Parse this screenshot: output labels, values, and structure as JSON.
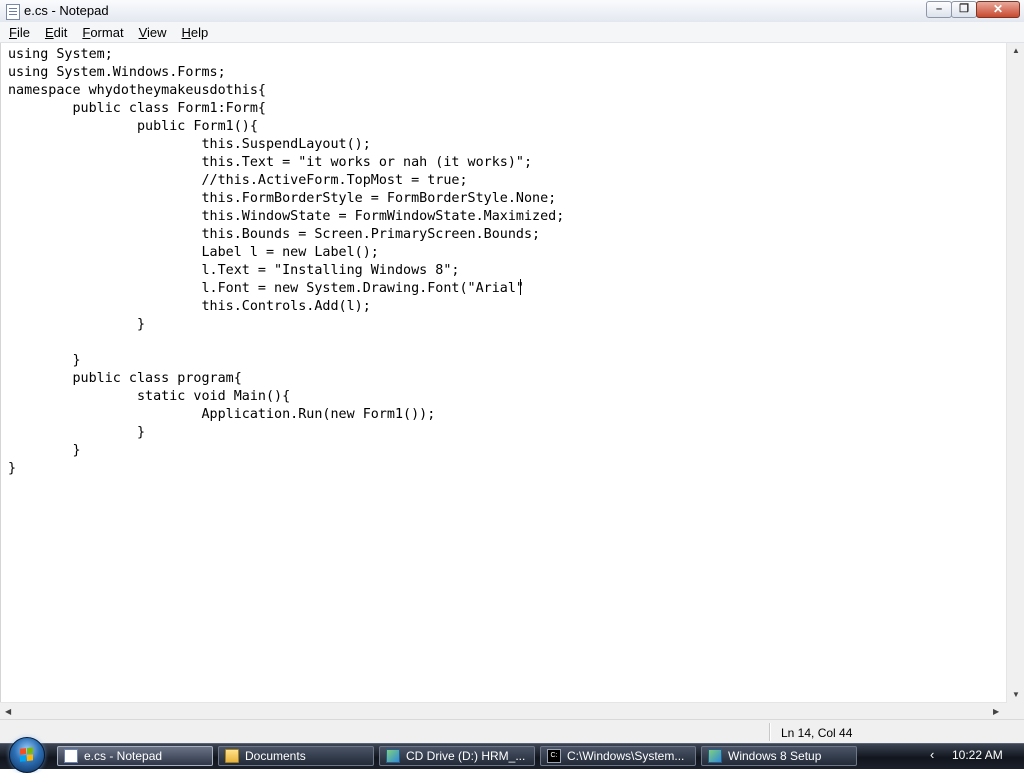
{
  "window": {
    "title": "e.cs - Notepad",
    "buttons": {
      "minimize": "–",
      "maximize": "❐",
      "close": "✕"
    }
  },
  "menu": {
    "items": [
      {
        "underline": "F",
        "rest": "ile"
      },
      {
        "underline": "E",
        "rest": "dit"
      },
      {
        "underline": "F",
        "rest": "ormat",
        "prefix": ""
      },
      {
        "underline": "V",
        "rest": "iew"
      },
      {
        "underline": "H",
        "rest": "elp"
      }
    ]
  },
  "editor": {
    "lines": [
      "using System;",
      "using System.Windows.Forms;",
      "namespace whydotheymakeusdothis{",
      "        public class Form1:Form{",
      "                public Form1(){",
      "                        this.SuspendLayout();",
      "                        this.Text = \"it works or nah (it works)\";",
      "                        //this.ActiveForm.TopMost = true;",
      "                        this.FormBorderStyle = FormBorderStyle.None;",
      "                        this.WindowState = FormWindowState.Maximized;",
      "                        this.Bounds = Screen.PrimaryScreen.Bounds;",
      "                        Label l = new Label();",
      "                        l.Text = \"Installing Windows 8\";",
      "                        l.Font = new System.Drawing.Font(\"Arial\"",
      "                        this.Controls.Add(l);",
      "                }",
      "",
      "        }",
      "        public class program{",
      "                static void Main(){",
      "                        Application.Run(new Form1());",
      "                }",
      "        }",
      "}"
    ]
  },
  "status": {
    "position": "Ln 14, Col 44"
  },
  "taskbar": {
    "buttons": [
      {
        "label": "e.cs - Notepad",
        "icon": "notepad-icon"
      },
      {
        "label": "Documents",
        "icon": "folder-icon"
      },
      {
        "label": "CD Drive (D:) HRM_...",
        "icon": "cd-drive-icon"
      },
      {
        "label": "C:\\Windows\\System...",
        "icon": "command-prompt-icon"
      },
      {
        "label": "Windows 8 Setup",
        "icon": "setup-icon"
      }
    ],
    "tray_chevron": "‹",
    "clock": "10:22 AM"
  }
}
